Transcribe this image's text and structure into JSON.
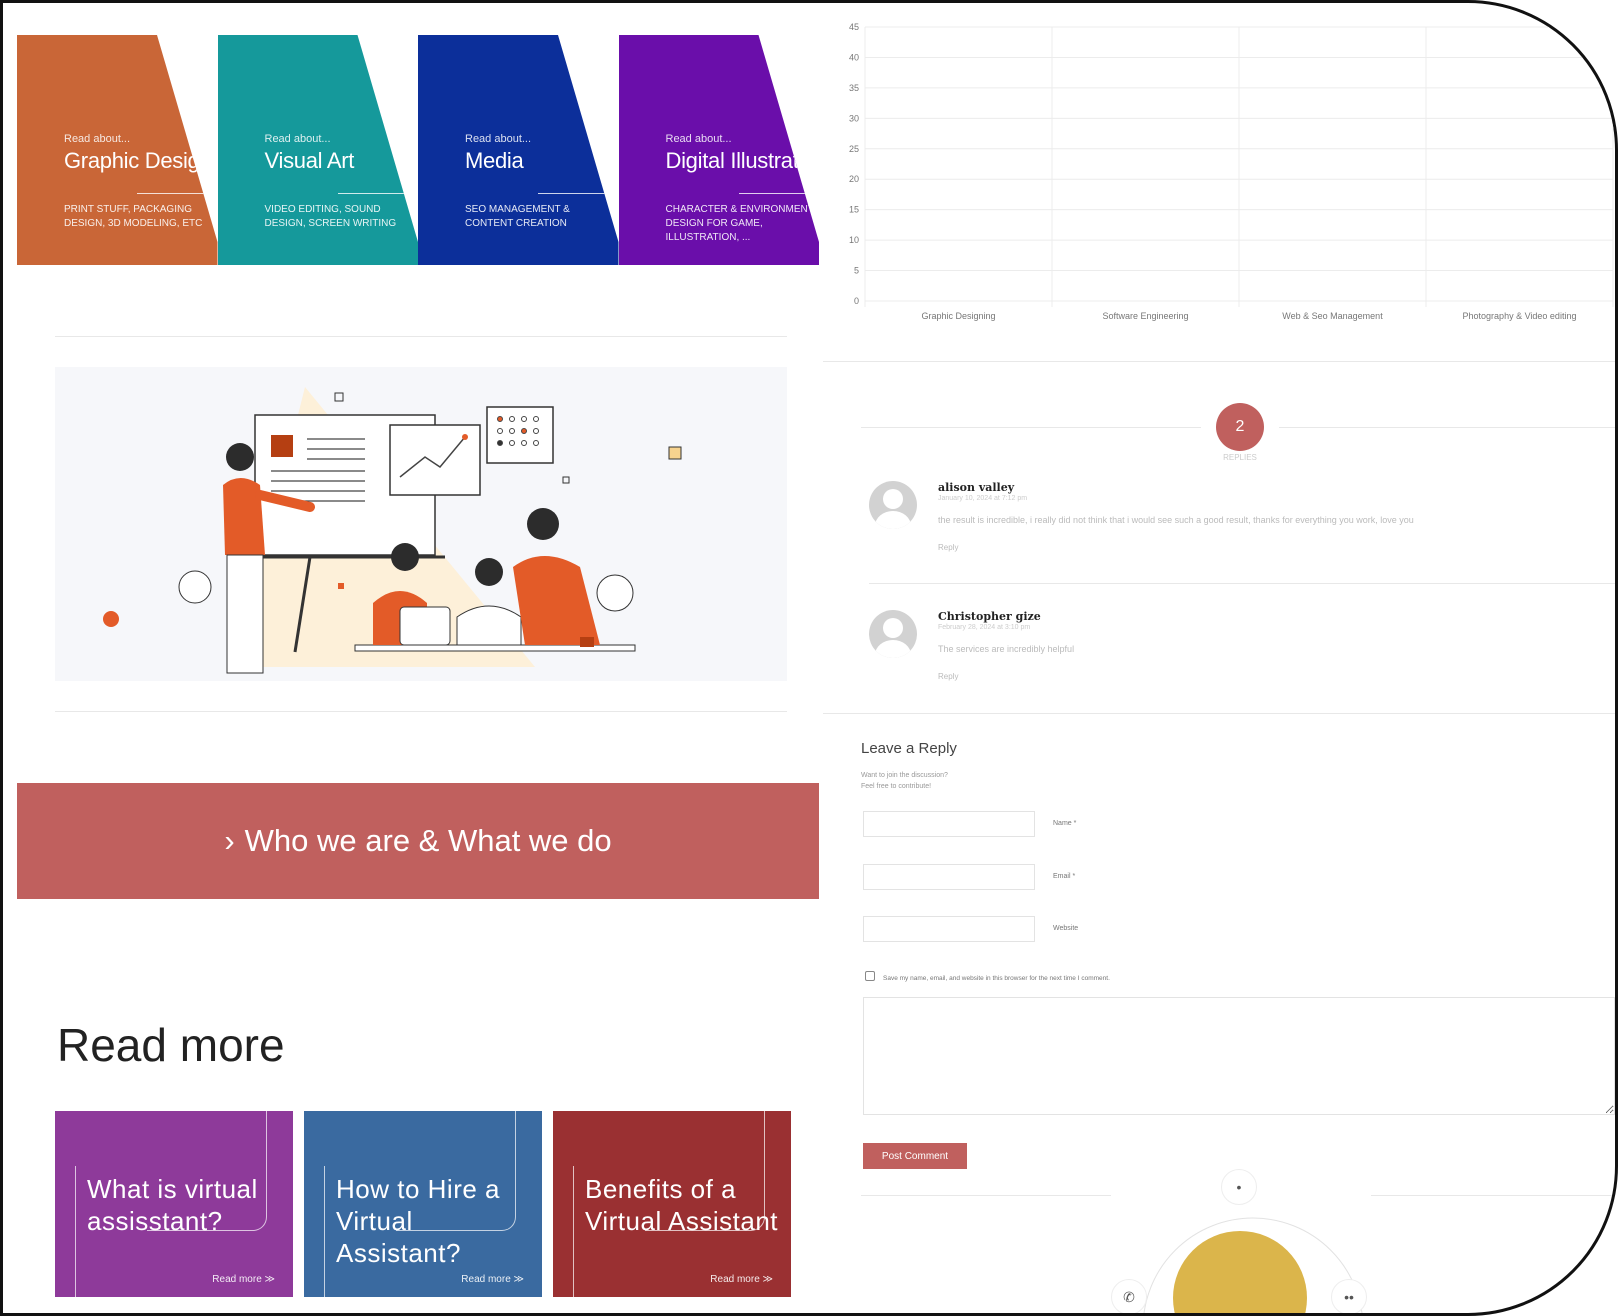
{
  "services": [
    {
      "pre": "Read about...",
      "title": "Graphic Design",
      "desc": "PRINT STUFF, PACKAGING DESIGN, 3D MODELING, etc",
      "color": "#c96637"
    },
    {
      "pre": "Read about...",
      "title": "Visual Art",
      "desc": "VIDEO EDITING, SOUND DESIGN, SCREEN WRITING",
      "color": "#15999b"
    },
    {
      "pre": "Read about...",
      "title": "Media",
      "desc": "SEO MANAGEMENT & CONTENT CREATION",
      "color": "#0c2f9a"
    },
    {
      "pre": "Read about...",
      "title": "Digital Illustration",
      "desc": "CHARACTER & ENVIRONMENT DESIGN FOR GAME, ILLUSTRATION, ...",
      "color": "#6a0eaa"
    }
  ],
  "who_banner": {
    "chevron": "›",
    "text": "Who we are & What we do"
  },
  "read_more": {
    "title": "Read more",
    "cards": [
      {
        "title": "What is virtual\nassisstant?",
        "more": "Read more ≫",
        "color": "#8e3a9a"
      },
      {
        "title": "How to Hire a\nVirtual Assistant?",
        "more": "Read more ≫",
        "color": "#3a6aa0"
      },
      {
        "title": "Benefits of a\nVirtual Assistant",
        "more": "Read more ≫",
        "color": "#9a3032"
      }
    ]
  },
  "chart_data": {
    "type": "bar",
    "categories": [
      "Graphic Designing",
      "Software Engineering",
      "Web & Seo Management",
      "Photography & Video editing"
    ],
    "values": [
      0,
      0,
      0,
      0
    ],
    "ylim": [
      0,
      45
    ],
    "yticks": [
      "0",
      "5",
      "10",
      "15",
      "20",
      "25",
      "30",
      "35",
      "40",
      "45"
    ],
    "grid": true
  },
  "comments": {
    "count": "2",
    "count_label": "REPLIES",
    "items": [
      {
        "name": "alison valley",
        "date": "January 10, 2024 at 7:12 pm",
        "text": "the result is incredible, i really did not think that i would see such a good result, thanks for everything you work, love you",
        "reply": "Reply"
      },
      {
        "name": "Christopher gize",
        "date": "February 28, 2024 at 3:10 pm",
        "text": "The services are incredibly helpful",
        "reply": "Reply"
      }
    ]
  },
  "reply_form": {
    "title": "Leave a Reply",
    "subtitle": "Want to join the discussion?\nFeel free to contribute!",
    "name_label": "Name *",
    "email_label": "Email *",
    "website_label": "Website",
    "save_label": "Save my name, email, and website in this browser for the next time I comment.",
    "submit": "Post Comment"
  },
  "floating": {
    "top_icon": "•",
    "whatsapp_icon": "✆",
    "more_icon": "••"
  },
  "colors": {
    "accent": "#c0605e",
    "logo": "#dbb54b"
  }
}
